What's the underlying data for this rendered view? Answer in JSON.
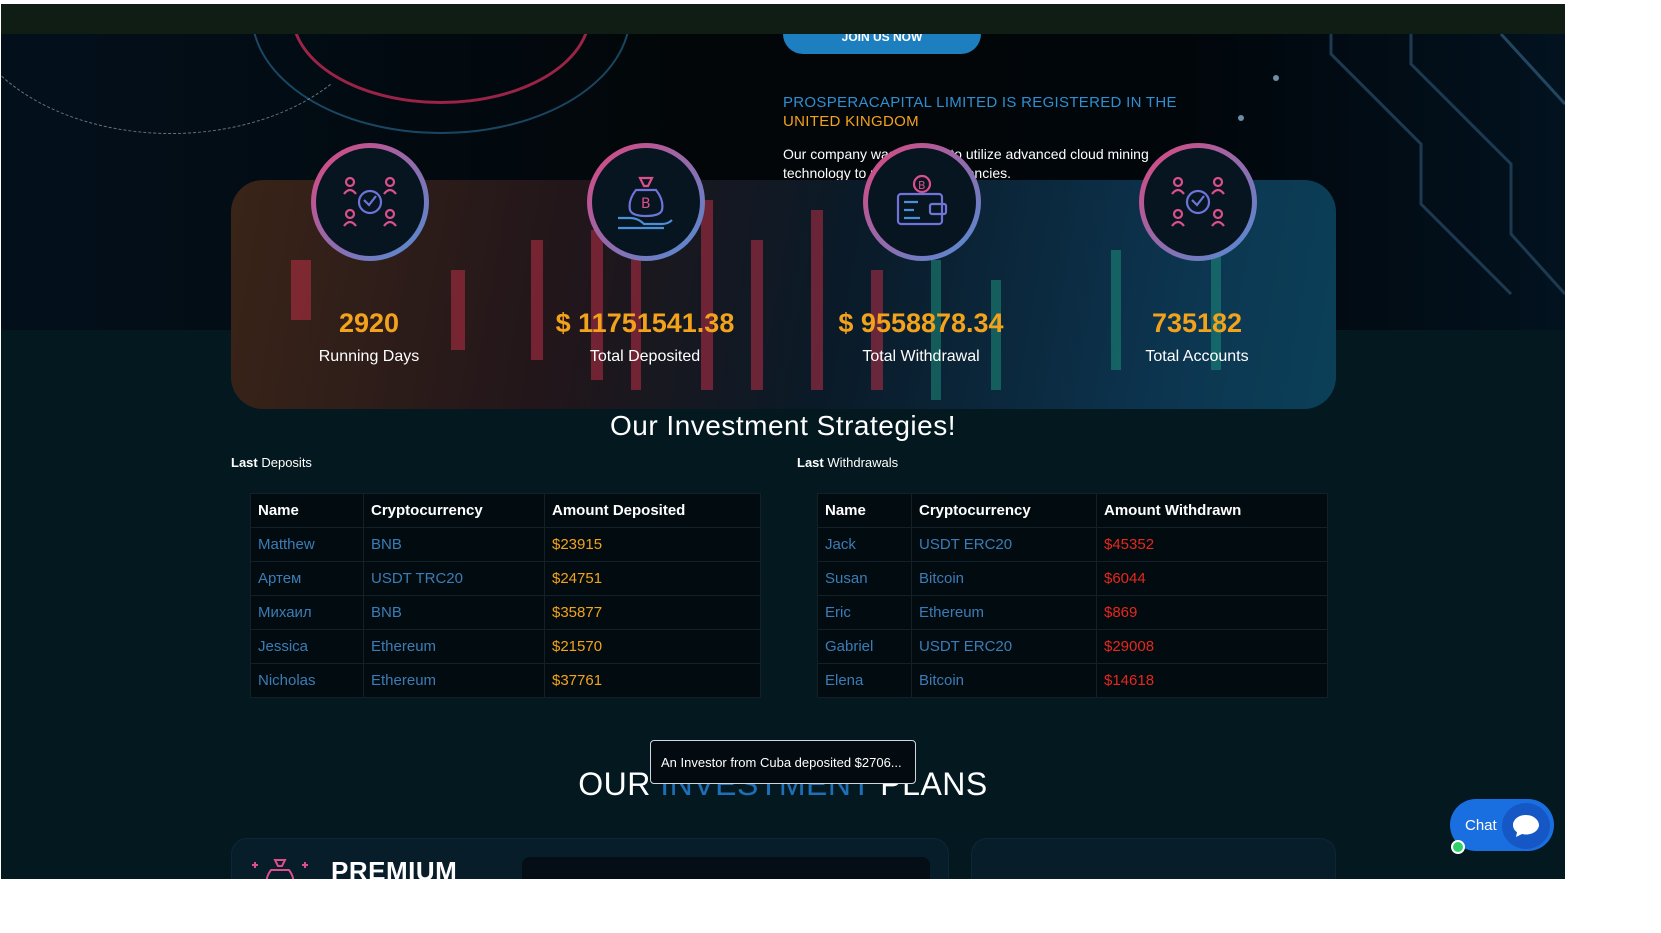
{
  "hero": {
    "cta_label": "JOIN US NOW",
    "registration_line1": "PROSPERACAPITAL LIMITED IS REGISTERED IN THE",
    "registration_line2": "UNITED KINGDOM",
    "intro_line1": "Our company was created to utilize advanced cloud mining",
    "intro_line2": "technology to mine cryptocurrencies."
  },
  "stats": [
    {
      "icon": "network-people-icon",
      "value": "2920",
      "label": "Running Days"
    },
    {
      "icon": "bitcoin-bag-hand-icon",
      "value": "$ 11751541.38",
      "label": "Total Deposited"
    },
    {
      "icon": "bitcoin-wallet-icon",
      "value": "$ 9558878.34",
      "label": "Total Withdrawal"
    },
    {
      "icon": "network-people-icon",
      "value": "735182",
      "label": "Total Accounts"
    }
  ],
  "strategies_title": "Our Investment Strategies!",
  "deposits": {
    "caption_bold": "Last",
    "caption_rest": " Deposits",
    "headers": [
      "Name",
      "Cryptocurrency",
      "Amount Deposited"
    ],
    "rows": [
      [
        "Matthew",
        "BNB",
        "$23915"
      ],
      [
        "Артем",
        "USDT TRC20",
        "$24751"
      ],
      [
        "Михаил",
        "BNB",
        "$35877"
      ],
      [
        "Jessica",
        "Ethereum",
        "$21570"
      ],
      [
        "Nicholas",
        "Ethereum",
        "$37761"
      ]
    ]
  },
  "withdrawals": {
    "caption_bold": "Last",
    "caption_rest": " Withdrawals",
    "headers": [
      "Name",
      "Cryptocurrency",
      "Amount Withdrawn"
    ],
    "rows": [
      [
        "Jack",
        "USDT ERC20",
        "$45352"
      ],
      [
        "Susan",
        "Bitcoin",
        "$6044"
      ],
      [
        "Eric",
        "Ethereum",
        "$869"
      ],
      [
        "Gabriel",
        "USDT ERC20",
        "$29008"
      ],
      [
        "Elena",
        "Bitcoin",
        "$14618"
      ]
    ]
  },
  "plans_title": {
    "word1": "OUR",
    "word2": "INVESTMENT",
    "word3": "PLANS"
  },
  "toast": "An Investor from Cuba deposited $2706...",
  "plan_card": {
    "name": "PREMIUM",
    "icon": "money-bag-icon"
  },
  "chat": {
    "label": "Chat",
    "icon": "chat-bubble-icon"
  },
  "colors": {
    "accent_orange": "#f3a21c",
    "accent_blue": "#2f8fd0",
    "withdraw_red": "#e5271d",
    "name_blue": "#3c7cb6",
    "background": "#041820",
    "chat_blue": "#1a6fe0"
  }
}
